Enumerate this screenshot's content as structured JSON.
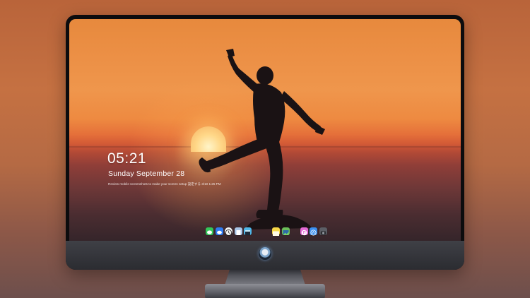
{
  "lock_screen": {
    "time": "05:21",
    "date": "Sunday September  28",
    "note": "Review mobile screenshots to make your screen setup 設定する 3/10 1:25 PM"
  },
  "dock": {
    "apps": [
      {
        "icon": "messages-icon",
        "color": "#34c759"
      },
      {
        "icon": "chat-icon",
        "color": "#2f7bf0"
      },
      {
        "icon": "clock-icon",
        "color": "#f2f2f2"
      },
      {
        "icon": "preview-icon",
        "color": "#a9c6e8"
      },
      {
        "icon": "clapper-icon",
        "color": "#4fb7e9"
      },
      {
        "icon": "notes-icon",
        "color": "#f7d848"
      },
      {
        "icon": "photos-icon",
        "color": "#6bbf59"
      },
      {
        "icon": "itunes-icon",
        "color": "#e46ad6"
      },
      {
        "icon": "app-store-icon",
        "color": "#3a8ff0"
      },
      {
        "icon": "camera-icon",
        "color": "#5c5f66"
      }
    ]
  },
  "colors": {
    "sky_top": "#e7893d",
    "sea": "#4b2d31",
    "bezel": "#0c0c0e",
    "chin": "#3f4046"
  }
}
